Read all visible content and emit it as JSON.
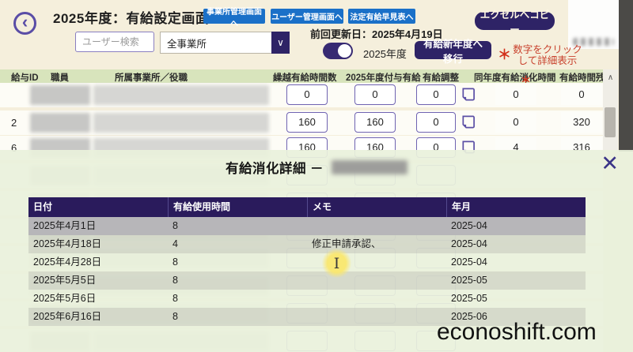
{
  "header": {
    "title": "2025年度：有給設定画面",
    "nav_buttons": [
      "事業所管理画面へ",
      "ユーザー管理画面へ",
      "法定有給早見表へ"
    ],
    "excel_button": "エクセルへコピー",
    "search_placeholder": "ユーザー検索",
    "office_filter_value": "全事業所",
    "last_updated": "前回更新日：2025年4月19日",
    "year_toggle_label": "2025年度",
    "migrate_button": "有給新年度へ移行",
    "note_line1": "数字をクリック",
    "note_line2": "して詳細表示"
  },
  "icons": {
    "back": "‹",
    "dropdown_chevron": "∨",
    "scroll_up": "∧",
    "close": "✕",
    "asterisk": "＊",
    "ibeam_cursor": "I",
    "note_icon": "page-with-folded-corner"
  },
  "main_table": {
    "columns": [
      "給与ID",
      "職員",
      "所属事業所／役職",
      "繰越有給時間数",
      "2025年度付与有給",
      "有給調整",
      "同年度有給消化時間",
      "有給時間残"
    ],
    "rows": [
      {
        "id": "",
        "carryover": "0",
        "granted": "0",
        "adjustment": "0",
        "used": "0",
        "remaining": "0"
      },
      {
        "id": "2",
        "carryover": "160",
        "granted": "160",
        "adjustment": "0",
        "used": "0",
        "remaining": "320"
      },
      {
        "id": "6",
        "carryover": "160",
        "granted": "160",
        "adjustment": "0",
        "used": "4",
        "remaining": "316"
      }
    ]
  },
  "modal": {
    "title": "有給消化詳細 －",
    "columns": [
      "日付",
      "有給使用時間",
      "メモ",
      "年月"
    ],
    "rows": [
      {
        "date": "2025年4月1日",
        "hours": "8",
        "memo": "",
        "month": "2025-04"
      },
      {
        "date": "2025年4月18日",
        "hours": "4",
        "memo": "修正申請承認、",
        "month": "2025-04"
      },
      {
        "date": "2025年4月28日",
        "hours": "8",
        "memo": "",
        "month": "2025-04"
      },
      {
        "date": "2025年5月5日",
        "hours": "8",
        "memo": "",
        "month": "2025-05"
      },
      {
        "date": "2025年5月6日",
        "hours": "8",
        "memo": "",
        "month": "2025-05"
      },
      {
        "date": "2025年6月16日",
        "hours": "8",
        "memo": "",
        "month": "2025-06"
      }
    ]
  },
  "watermark": "econoshift.com",
  "colors": {
    "background_cream": "#f5efdc",
    "header_band_green": "#d8e4bc",
    "modal_green": "#e9f1db",
    "primary_purple": "#2e2366",
    "accent_purple_border": "#6f63b2",
    "nav_blue": "#1a70c8",
    "alert_red": "#d2301a",
    "selected_row_gray": "#b7b6b9",
    "edge_strip_gray": "#4b4a47"
  }
}
